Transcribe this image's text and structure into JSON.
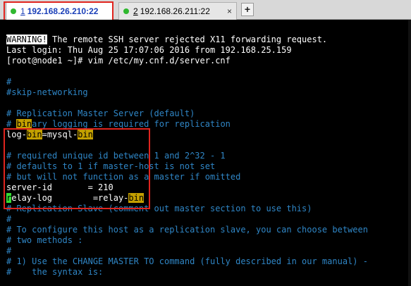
{
  "tabs": [
    {
      "number": "1",
      "label": " 192.168.26.210:22"
    },
    {
      "number": "2",
      "label": " 192.168.26.211:22",
      "close": "×"
    }
  ],
  "new_tab": "+",
  "terminal": {
    "l1_warn": "WARNING!",
    "l1_rest": " The remote SSH server rejected X11 forwarding request.",
    "l2": "Last login: Thu Aug 25 17:07:06 2016 from 192.168.25.159",
    "l3": "[root@node1 ~]# vim /etc/my.cnf.d/server.cnf",
    "l5": "#",
    "l6": "#skip-networking",
    "l8": "# Replication Master Server (default)",
    "l9a": "# ",
    "l9b": "bin",
    "l9c": "ary logging is required for replication",
    "l10a": "log-",
    "l10b": "bin",
    "l10c": "=mysql-",
    "l10d": "bin",
    "l12": "# required unique id between 1 and 2^32 - 1",
    "l13": "# defaults to 1 if master-host is not set",
    "l14": "# but will not function as a master if omitted",
    "l15": "server-id       = 210",
    "l16a": "r",
    "l16b": "elay-log        =relay-",
    "l16c": "bin",
    "l17": "# Replication Slave (comment out master section to use this)",
    "l18": "#",
    "l19": "# To configure this host as a replication slave, you can choose between",
    "l20": "# two methods :",
    "l21": "#",
    "l22": "# 1) Use the CHANGE MASTER TO command (fully described in our manual) -",
    "l23": "#    the syntax is:"
  }
}
